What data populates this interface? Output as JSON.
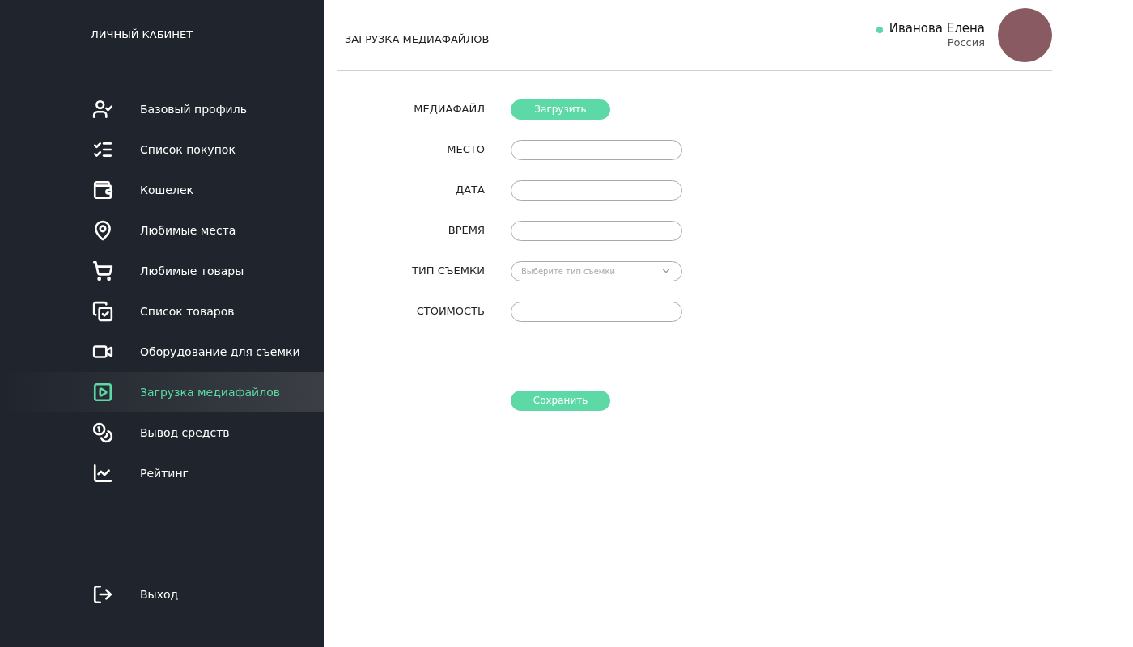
{
  "sidebar": {
    "title": "ЛИЧНЫЙ КАБИНЕТ",
    "items": [
      {
        "label": "Базовый профиль",
        "selected": false
      },
      {
        "label": "Список покупок",
        "selected": false
      },
      {
        "label": "Кошелек",
        "selected": false
      },
      {
        "label": "Любимые места",
        "selected": false
      },
      {
        "label": "Любимые товары",
        "selected": false
      },
      {
        "label": "Список товаров",
        "selected": false
      },
      {
        "label": "Оборудование для съемки",
        "selected": false
      },
      {
        "label": "Загрузка медиафайлов",
        "selected": true
      },
      {
        "label": "Вывод средств",
        "selected": false
      },
      {
        "label": "Рейтинг",
        "selected": false
      }
    ],
    "logout": {
      "label": "Выход"
    }
  },
  "header": {
    "title": "ЗАГРУЗКА МЕДИАФАЙЛОВ",
    "user": {
      "name": "Иванова Елена",
      "country": "Россия",
      "online": true
    }
  },
  "form": {
    "fields": [
      {
        "label": "МЕДИАФАЙЛ",
        "kind": "button",
        "button": "Загрузить"
      },
      {
        "label": "МЕСТО",
        "kind": "text"
      },
      {
        "label": "ДАТА",
        "kind": "text"
      },
      {
        "label": "ВРЕМЯ",
        "kind": "text"
      },
      {
        "label": "ТИП СЪЕМКИ",
        "kind": "select",
        "placeholder": "Выберите тип съемки"
      },
      {
        "label": "СТОИМОСТЬ",
        "kind": "text"
      }
    ],
    "submit": "Сохранить"
  }
}
